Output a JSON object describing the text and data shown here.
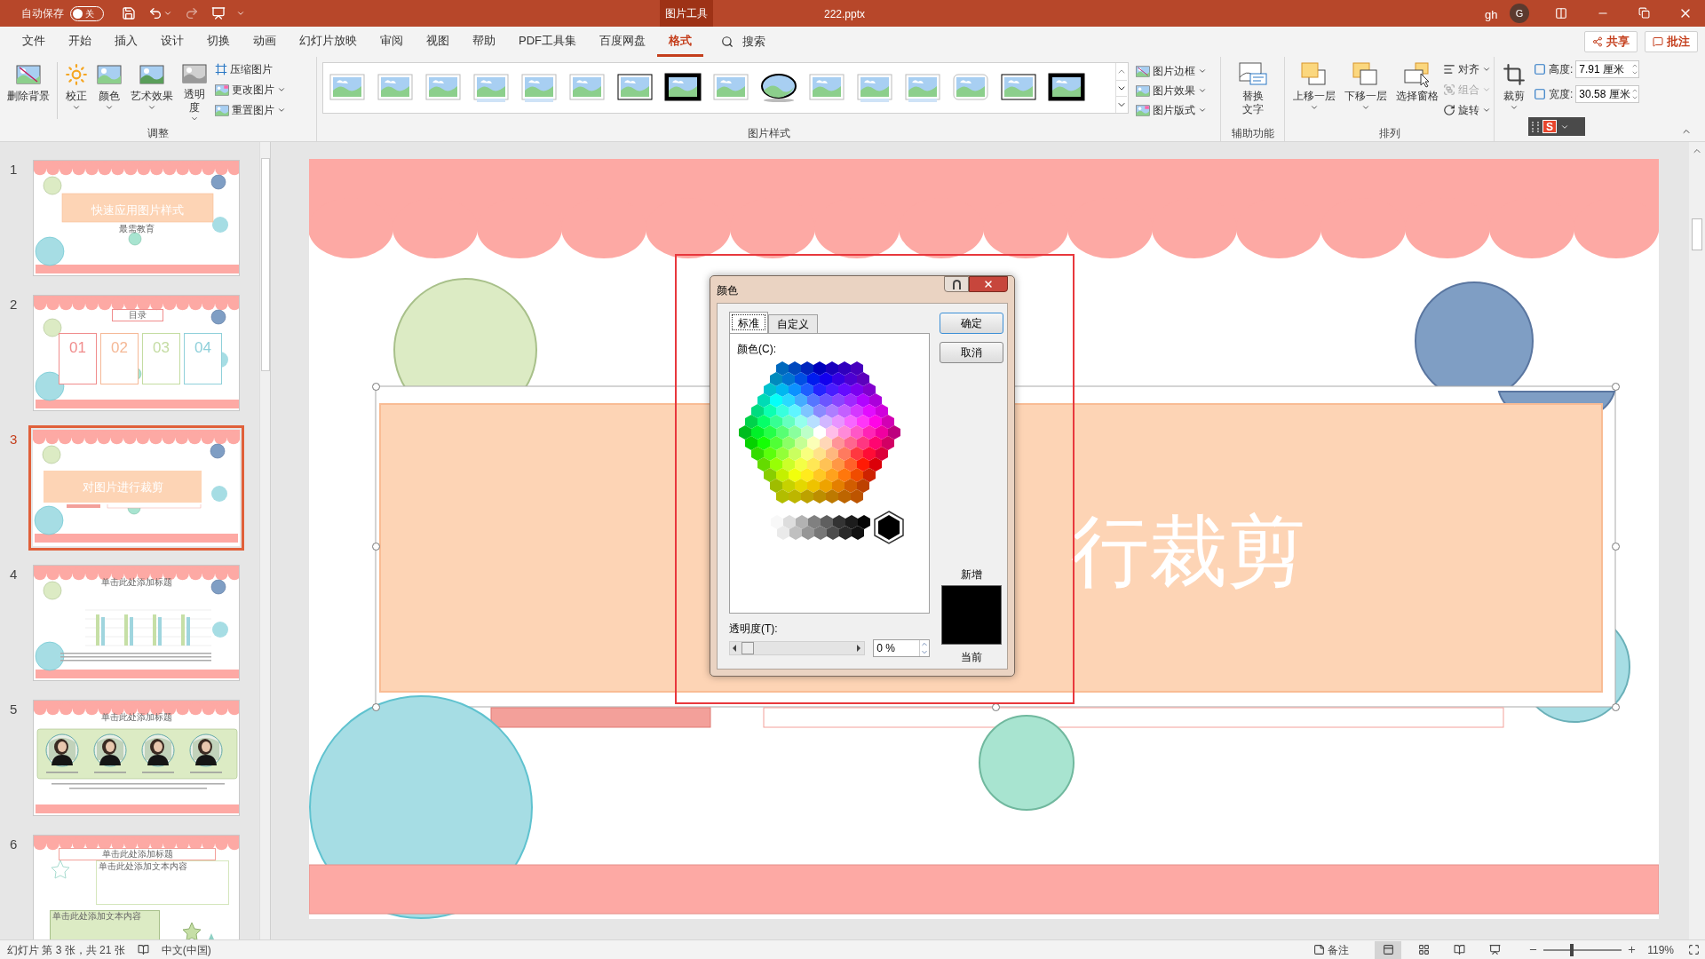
{
  "title_bar": {
    "autosave_label": "自动保存",
    "autosave": {
      "on": false,
      "label": "关"
    },
    "context_tab": "图片工具",
    "filename": "222.pptx",
    "user": "gh",
    "avatar": "G"
  },
  "menu_tabs": [
    {
      "label": "文件",
      "selected": false
    },
    {
      "label": "开始",
      "selected": false
    },
    {
      "label": "插入",
      "selected": false
    },
    {
      "label": "设计",
      "selected": false
    },
    {
      "label": "切换",
      "selected": false
    },
    {
      "label": "动画",
      "selected": false
    },
    {
      "label": "幻灯片放映",
      "selected": false
    },
    {
      "label": "审阅",
      "selected": false
    },
    {
      "label": "视图",
      "selected": false
    },
    {
      "label": "帮助",
      "selected": false
    },
    {
      "label": "PDF工具集",
      "selected": false
    },
    {
      "label": "百度网盘",
      "selected": false
    },
    {
      "label": "格式",
      "selected": true
    }
  ],
  "search": {
    "label": "搜索"
  },
  "actions": [
    {
      "label": "共享"
    },
    {
      "label": "批注"
    }
  ],
  "ribbon": {
    "adjust": {
      "label": "调整",
      "large": [
        {
          "label": "删除背景",
          "dropdown": false,
          "wrap": false
        },
        {
          "label": "校正",
          "dropdown": true,
          "wrap": false
        },
        {
          "label": "颜色",
          "dropdown": true,
          "wrap": false
        },
        {
          "label": "艺术效果",
          "dropdown": true,
          "wrap": false
        },
        {
          "label": "透明度",
          "dropdown": true,
          "wrap": true
        }
      ],
      "small": [
        {
          "label": "压缩图片",
          "dropdown": false
        },
        {
          "label": "更改图片",
          "dropdown": true
        },
        {
          "label": "重置图片",
          "dropdown": true
        }
      ]
    },
    "styles": {
      "label": "图片样式",
      "commands": [
        {
          "label": "图片边框"
        },
        {
          "label": "图片效果"
        },
        {
          "label": "图片版式"
        }
      ]
    },
    "accessibility": {
      "label": "辅助功能",
      "button": "替换文字"
    },
    "arrange": {
      "label": "排列",
      "large": [
        {
          "label": "上移一层",
          "dropdown": true
        },
        {
          "label": "下移一层",
          "dropdown": true
        },
        {
          "label": "选择窗格",
          "dropdown": false
        }
      ],
      "small": [
        {
          "label": "对齐",
          "disabled": false
        },
        {
          "label": "组合",
          "disabled": true
        },
        {
          "label": "旋转",
          "disabled": false
        }
      ]
    },
    "size": {
      "crop": "裁剪",
      "fields": [
        {
          "label": "高度:",
          "value": "7.91 厘米"
        },
        {
          "label": "宽度:",
          "value": "30.58 厘米"
        }
      ]
    },
    "ime_toolbar": {
      "logo": "S"
    }
  },
  "slides": [
    {
      "number": "1",
      "selected": false,
      "kind": "cover",
      "title": "快速应用图片样式",
      "subtitle": "最需教育"
    },
    {
      "number": "2",
      "selected": false,
      "kind": "toc",
      "title": "目录",
      "items": [
        {
          "number": "01",
          "color": "#f08c8c"
        },
        {
          "number": "02",
          "color": "#f5b896"
        },
        {
          "number": "03",
          "color": "#c4dca2"
        },
        {
          "number": "04",
          "color": "#8fd0da"
        }
      ]
    },
    {
      "number": "3",
      "selected": true,
      "kind": "section",
      "title": "对图片进行裁剪"
    },
    {
      "number": "4",
      "selected": false,
      "kind": "chart",
      "title": "单击此处添加标题"
    },
    {
      "number": "5",
      "selected": false,
      "kind": "photos",
      "title": "单击此处添加标题"
    },
    {
      "number": "6",
      "selected": false,
      "kind": "text",
      "title": "单击此处添加标题",
      "texts": [
        "单击此处添加文本内容",
        "单击此处添加文本内容"
      ]
    }
  ],
  "slide": {
    "title_visible": "行裁剪"
  },
  "dialog": {
    "title": "颜色",
    "tabs": [
      {
        "label": "标准",
        "selected": true
      },
      {
        "label": "自定义",
        "selected": false
      }
    ],
    "buttons": [
      {
        "label": "确定"
      },
      {
        "label": "取消"
      }
    ],
    "colors_label": "颜色(C):",
    "transparency_label": "透明度(T):",
    "transparency": {
      "level": 0
    },
    "transparency_value": "0 %",
    "new_label": "新增",
    "current_label": "当前"
  },
  "status_bar": {
    "slide_info": "幻灯片 第 3 张，共 21 张",
    "language": "中文(中国)",
    "notes": "备注",
    "views": [
      {
        "selected": true
      },
      {
        "selected": false
      },
      {
        "selected": false
      },
      {
        "selected": false
      }
    ],
    "zoom": {
      "level": 0.35
    },
    "zoom_value": "119%"
  }
}
